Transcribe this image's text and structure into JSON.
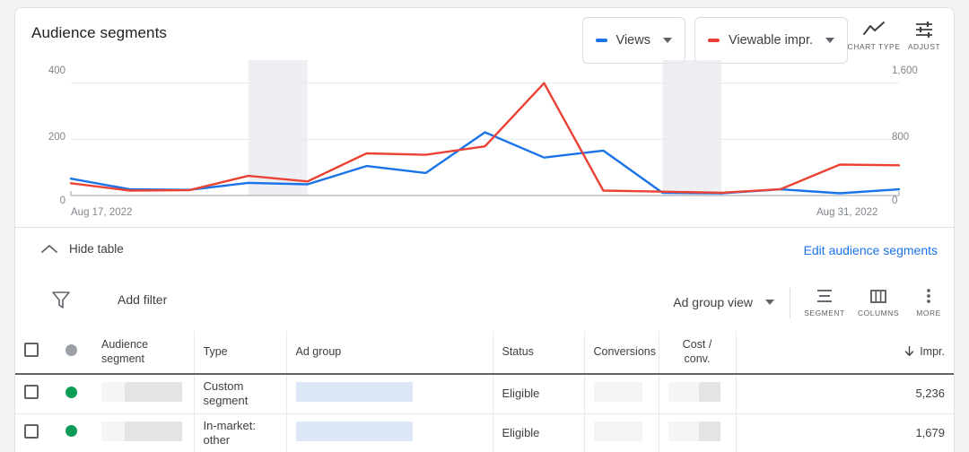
{
  "chart": {
    "title": "Audience segments",
    "legend": [
      {
        "label": "Views",
        "color": "#1a73e8",
        "icon": "chevron-down-icon"
      },
      {
        "label": "Viewable impr.",
        "color": "#ea4335",
        "icon": "chevron-down-icon"
      }
    ],
    "actions": [
      {
        "label": "CHART TYPE",
        "icon": "line-chart-icon"
      },
      {
        "label": "ADJUST",
        "icon": "sliders-icon"
      }
    ],
    "left_axis_ticks": [
      "400",
      "200",
      "0"
    ],
    "right_axis_ticks": [
      "1,600",
      "800",
      "0"
    ],
    "date_start": "Aug 17, 2022",
    "date_end": "Aug 31, 2022"
  },
  "chart_data": {
    "type": "line",
    "title": "Audience segments",
    "xlabel": "",
    "ylabel": "Views",
    "y2label": "Viewable impr.",
    "ylim": [
      0,
      450
    ],
    "y2lim": [
      0,
      1800
    ],
    "yticks": [
      0,
      200,
      400
    ],
    "y2ticks": [
      0,
      800,
      1600
    ],
    "grid": true,
    "legend_position": "top-right",
    "x": [
      "Aug 17, 2022",
      "Aug 18, 2022",
      "Aug 19, 2022",
      "Aug 20, 2022",
      "Aug 21, 2022",
      "Aug 22, 2022",
      "Aug 23, 2022",
      "Aug 24, 2022",
      "Aug 25, 2022",
      "Aug 26, 2022",
      "Aug 27, 2022",
      "Aug 28, 2022",
      "Aug 29, 2022",
      "Aug 30, 2022",
      "Aug 31, 2022"
    ],
    "shaded_bands": [
      {
        "from": "Aug 20, 2022",
        "to": "Aug 21, 2022"
      },
      {
        "from": "Aug 27, 2022",
        "to": "Aug 28, 2022"
      }
    ],
    "series": [
      {
        "name": "Views",
        "color": "#1a73e8",
        "axis": "left",
        "values": [
          60,
          22,
          20,
          45,
          40,
          105,
          80,
          225,
          135,
          160,
          10,
          8,
          22,
          8,
          22
        ]
      },
      {
        "name": "Viewable impr.",
        "color": "#ea4335",
        "axis": "right",
        "values": [
          175,
          70,
          75,
          280,
          200,
          600,
          580,
          700,
          1600,
          70,
          55,
          40,
          90,
          440,
          430
        ]
      }
    ]
  },
  "hide_bar": {
    "hide_table_label": "Hide table",
    "hide_table_icon": "chevron-up-icon",
    "edit_link": "Edit audience segments"
  },
  "toolbar": {
    "filter_icon": "filter-funnel-icon",
    "add_filter_label": "Add filter",
    "view_label": "Ad group view",
    "view_icon": "chevron-down-icon",
    "actions": [
      {
        "label": "SEGMENT",
        "icon": "segment-icon"
      },
      {
        "label": "COLUMNS",
        "icon": "columns-icon"
      },
      {
        "label": "MORE",
        "icon": "more-vertical-icon"
      }
    ]
  },
  "table": {
    "headers": {
      "checkbox": "select-all",
      "status_dot": "status",
      "audience_segment": "Audience segment",
      "type": "Type",
      "ad_group": "Ad group",
      "status": "Status",
      "conversions": "Conversions",
      "cost_conv": "Cost / conv.",
      "blank": "",
      "impr": "Impr.",
      "impr_sort_icon": "arrow-down-icon"
    },
    "rows": [
      {
        "status_color": "#0d9d57",
        "audience_segment": "",
        "type": "Custom segment",
        "ad_group": "",
        "status": "Eligible",
        "conversions": "",
        "cost_conv": "",
        "blank": "",
        "impr": "5,236"
      },
      {
        "status_color": "#0d9d57",
        "audience_segment": "",
        "type": "In-market: other",
        "ad_group": "",
        "status": "Eligible",
        "conversions": "",
        "cost_conv": "",
        "blank": "",
        "impr": "1,679"
      }
    ]
  }
}
